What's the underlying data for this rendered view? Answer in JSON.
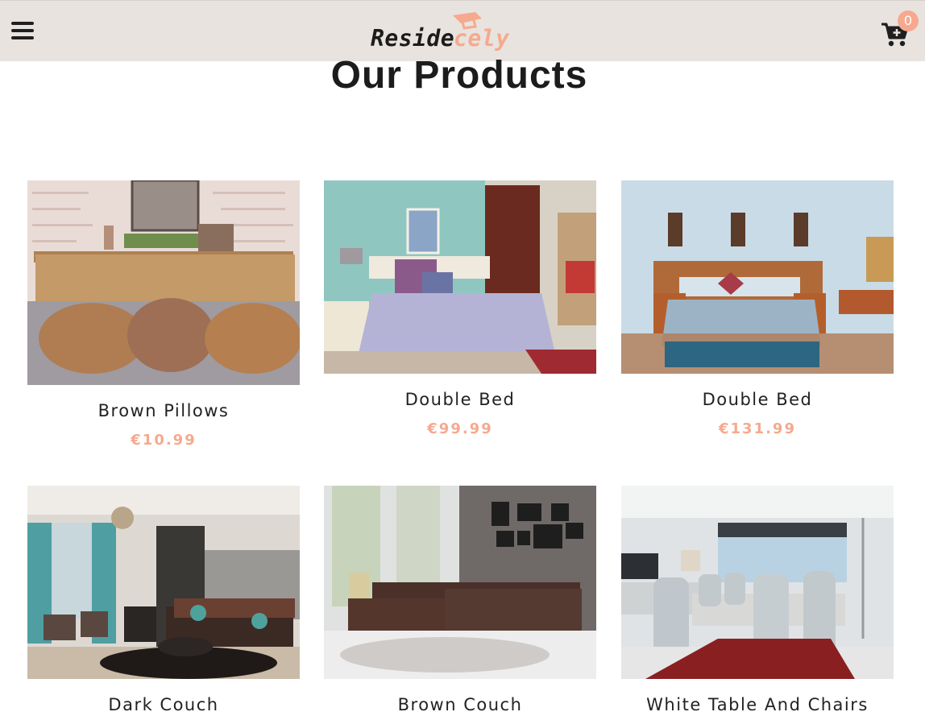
{
  "header": {
    "menu_icon": "hamburger-icon",
    "logo_part1": "Reside",
    "logo_part2": "cely",
    "cart_icon": "cart-plus-icon",
    "cart_count": "0"
  },
  "main": {
    "title": "Our Products"
  },
  "products": [
    {
      "name": "Brown Pillows",
      "price": "€10.99"
    },
    {
      "name": "Double Bed",
      "price": "€99.99"
    },
    {
      "name": "Double Bed",
      "price": "€131.99"
    },
    {
      "name": "Dark Couch",
      "price": ""
    },
    {
      "name": "Brown Couch",
      "price": ""
    },
    {
      "name": "White Table And Chairs",
      "price": ""
    }
  ],
  "colors": {
    "accent": "#f6a98e",
    "header_bg": "#e8e3df",
    "text": "#222222"
  }
}
